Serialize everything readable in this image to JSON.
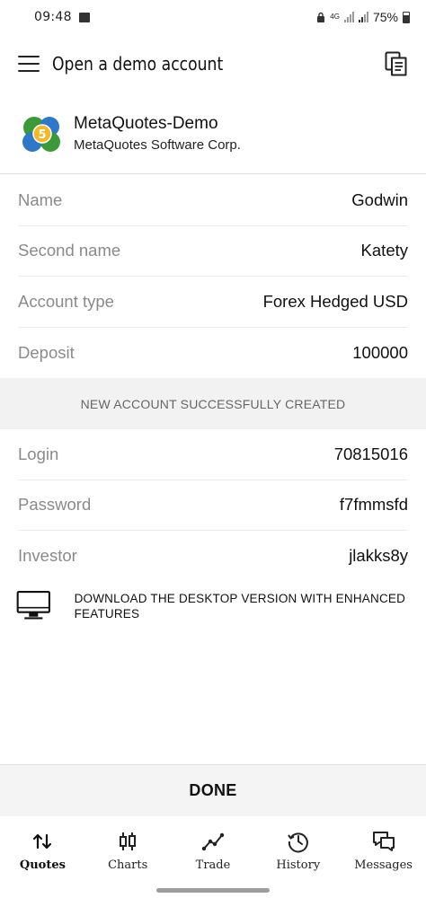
{
  "status_bar": {
    "time": "09:48",
    "network": "4G",
    "battery": "75%"
  },
  "app_bar": {
    "title": "Open a demo account"
  },
  "server": {
    "name": "MetaQuotes-Demo",
    "company": "MetaQuotes Software Corp."
  },
  "account": [
    {
      "label": "Name",
      "value": "Godwin"
    },
    {
      "label": "Second name",
      "value": "Katety"
    },
    {
      "label": "Account type",
      "value": "Forex Hedged USD"
    },
    {
      "label": "Deposit",
      "value": "100000"
    }
  ],
  "banner": "NEW ACCOUNT SUCCESSFULLY CREATED",
  "credentials": [
    {
      "label": "Login",
      "value": "70815016"
    },
    {
      "label": "Password",
      "value": "f7fmmsfd"
    },
    {
      "label": "Investor",
      "value": "jlakks8y"
    }
  ],
  "download": {
    "text": "DOWNLOAD THE DESKTOP VERSION WITH ENHANCED FEATURES",
    "icon": "desktop-monitor-icon"
  },
  "done_label": "DONE",
  "bottom_nav": [
    {
      "label": "Quotes",
      "icon": "quotes-arrows-icon",
      "active": true
    },
    {
      "label": "Charts",
      "icon": "candlestick-icon",
      "active": false
    },
    {
      "label": "Trade",
      "icon": "trade-line-icon",
      "active": false
    },
    {
      "label": "History",
      "icon": "history-clock-icon",
      "active": false
    },
    {
      "label": "Messages",
      "icon": "messages-bubbles-icon",
      "active": false
    }
  ]
}
